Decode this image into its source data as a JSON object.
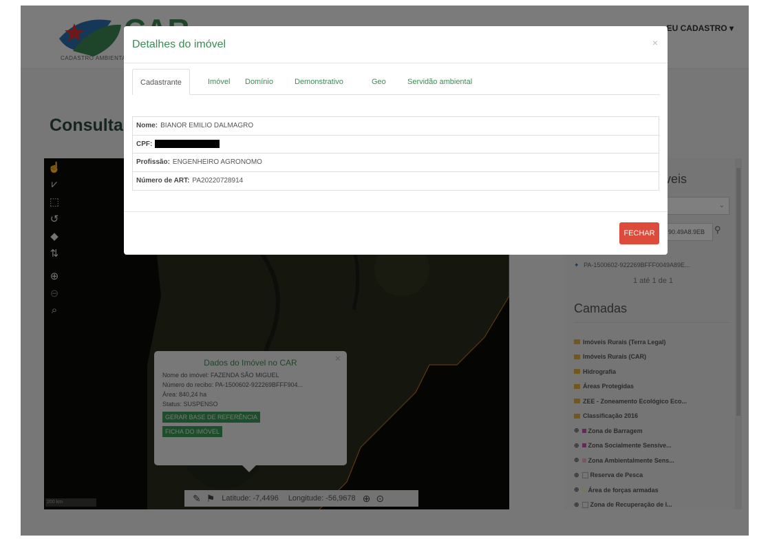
{
  "header": {
    "logo_text": "CAR",
    "logo_subtitle": "CADASTRO AMBIENTAL RURAL",
    "user_menu": "EU CADASTRO ▾"
  },
  "page": {
    "title": "Consulta"
  },
  "map": {
    "tools": [
      "hand-icon",
      "draw-line-icon",
      "select-area-icon",
      "measure-icon",
      "eraser-icon",
      "layers-select-icon",
      "zoom-in-icon",
      "zoom-out-icon",
      "zoom-extent-icon"
    ],
    "scale": "200 km",
    "coords": {
      "lat_label": "Latitude:",
      "lat": "-7,4496",
      "lon_label": "Longitude:",
      "lon": "-56,9678"
    },
    "popup": {
      "title": "Dados do Imóvel no CAR",
      "nome_label": "Nome do imóvel:",
      "nome": "FAZENDA SÃO MIGUEL",
      "recibo_label": "Número do recibo:",
      "recibo": "PA-1500602-922269BFFF904...",
      "area_label": "Área:",
      "area": "840,24 ha",
      "status_label": "Status:",
      "status": "SUSPENSO",
      "btn_base": "GERAR BASE DE REFERÊNCIA",
      "btn_ficha": "FICHA DO IMÓVEL"
    }
  },
  "right_panel": {
    "title": "veis",
    "search_value": "90.49A8.9EB",
    "result_code": "PA-1500602-922269BFFF0049A89E...",
    "paging": "1 até 1 de 1",
    "layers_title": "Camadas",
    "layers": [
      {
        "type": "folder",
        "label": "Imóveis Rurais (Terra Legal)"
      },
      {
        "type": "folder",
        "label": "Imóveis Rurais (CAR)"
      },
      {
        "type": "folder",
        "label": "Hidrografia"
      },
      {
        "type": "folder",
        "label": "Áreas Protegidas"
      },
      {
        "type": "folder",
        "label": "ZEE - Zoneamento Ecológico Eco..."
      },
      {
        "type": "folder",
        "label": "Classificação 2016"
      },
      {
        "type": "eye",
        "label": "Zona de Barragem",
        "color": "#d04fb0"
      },
      {
        "type": "eye",
        "label": "Zona Socialmente Sensíve...",
        "color": "#d04fb0"
      },
      {
        "type": "eye",
        "label": "Zona Ambientalmente Sens...",
        "color": "#f0b0c0"
      },
      {
        "type": "img",
        "label": "Reserva de Pesca"
      },
      {
        "type": "eye",
        "label": "Área de forças armadas",
        "color": "#eeeebb"
      },
      {
        "type": "img",
        "label": "Zona de Recuperação de I..."
      }
    ]
  },
  "modal": {
    "title": "Detalhes do imóvel",
    "close": "×",
    "tabs": [
      "Cadastrante",
      "Imóvel",
      "Domínio",
      "Demonstrativo",
      "Geo",
      "Servidão ambiental"
    ],
    "rows": [
      {
        "label": "Nome:",
        "value": "BIANOR EMILIO DALMAGRO"
      },
      {
        "label": "CPF:",
        "value": ""
      },
      {
        "label": "Profissão:",
        "value": "ENGENHEIRO AGRONOMO"
      },
      {
        "label": "Número de ART:",
        "value": "PA20220728914"
      }
    ],
    "fechar": "FECHAR"
  },
  "colors": {
    "accent_green": "#3c8a55",
    "danger": "#dd4b3a",
    "title_dark": "#2d4b45"
  }
}
